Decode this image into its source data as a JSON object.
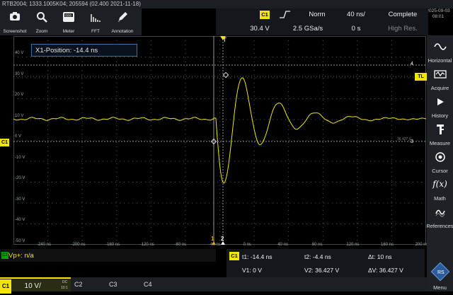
{
  "title_bar": "RTB2004; 1333.1005K04; 205594 (02.400 2021-11-18)",
  "datetime": {
    "date": "2025-09-03",
    "time": "08:01"
  },
  "toolbar": [
    {
      "label": "Screenshot",
      "icon": "camera-icon"
    },
    {
      "label": "Zoom",
      "icon": "magnifier-icon"
    },
    {
      "label": "Meter",
      "icon": "meter-icon"
    },
    {
      "label": "FFT",
      "icon": "fft-icon"
    },
    {
      "label": "Annotation",
      "icon": "pen-icon"
    }
  ],
  "acquisition": {
    "channel": "C1",
    "trigger_level": "30.4 V",
    "trigger_mode": "Norm",
    "timebase": "40 ns/",
    "status": "Complete",
    "sample_rate": "2.5 GSa/s",
    "position": "0 s",
    "mode": "High Res."
  },
  "right_panel": [
    {
      "label": "Horizontal",
      "icon": "wave-icon"
    },
    {
      "label": "Acquire",
      "icon": "acquire-icon"
    },
    {
      "label": "History",
      "icon": "play-icon"
    },
    {
      "label": "Measure",
      "icon": "measure-icon"
    },
    {
      "label": "Cursor",
      "icon": "cursor-icon"
    },
    {
      "label": "Math",
      "icon": "fx-icon"
    },
    {
      "label": "References",
      "icon": "reference-icon"
    },
    {
      "label": "Menu",
      "icon": "menu-icon"
    }
  ],
  "x1_position": "X1-Position: -14.4 ns",
  "y_axis_labels": [
    "40 V",
    "30 V",
    "20 V",
    "10 V",
    "0 V",
    "-10 V",
    "-20 V",
    "-30 V",
    "-40 V",
    "-50 V"
  ],
  "x_axis_labels": [
    "-240 ns",
    "-200 ns",
    "-160 ns",
    "-120 ns",
    "-80 ns",
    "-40 ns",
    "0 ns",
    "40 ns",
    "80 ns",
    "120 ns",
    "160 ns",
    "200 ns"
  ],
  "markers": {
    "c1": "C1",
    "tl": "TL",
    "cursor4": "4",
    "cursor3": "3",
    "t": "T",
    "cursor1": "1",
    "cursor2": "2",
    "ref": "36.427 V"
  },
  "measurement": {
    "channel": "C2",
    "text": "Vp+: n/a"
  },
  "cursor_readout": {
    "channel": "C1",
    "t1": "t1: -14.4 ns",
    "t2": "t2: -4.4 ns",
    "dt": "Δt: 10 ns",
    "v1": "V1: 0 V",
    "v2": "V2: 36.427 V",
    "dv": "ΔV: 36.427 V"
  },
  "channel_bar": {
    "c1": "C1",
    "c1_scale": "10 V/",
    "c1_coupling": "DC",
    "c1_div": "10:1",
    "c2": "C2",
    "c3": "C3",
    "c4": "C4"
  },
  "colors": {
    "ch1": "#f2e600",
    "accent": "#3a6ea5",
    "ch2": "#00a000"
  }
}
